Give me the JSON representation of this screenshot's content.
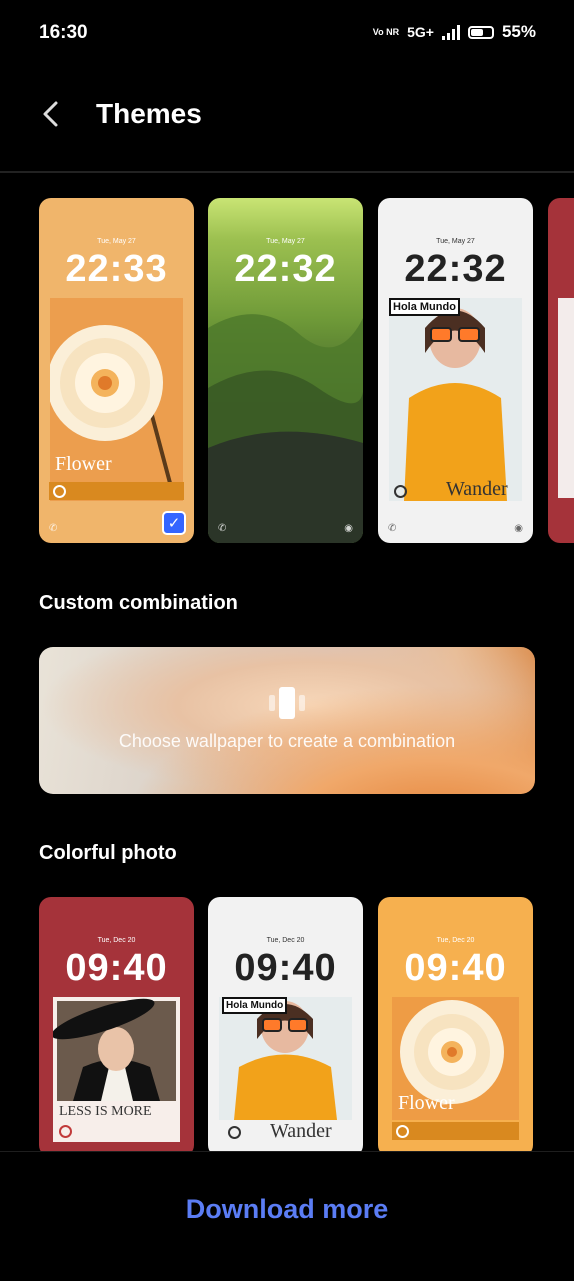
{
  "status": {
    "time": "16:30",
    "volte": "Vo NR",
    "network": "5G+",
    "battery": "55%",
    "battery_level": 0.55
  },
  "header": {
    "title": "Themes"
  },
  "themes": [
    {
      "date": "Tue, May 27",
      "clock": "22:33",
      "caption": "Flower",
      "selected": true
    },
    {
      "date": "Tue, May 27",
      "clock": "22:32"
    },
    {
      "date": "Tue, May 27",
      "clock": "22:32",
      "caption": "Wander",
      "sticker": "Hola Mundo"
    }
  ],
  "sections": {
    "custom": "Custom combination",
    "colorful": "Colorful photo"
  },
  "combo": {
    "text": "Choose wallpaper to create a combination"
  },
  "colorful": [
    {
      "date": "Tue, Dec 20",
      "clock": "09:40",
      "caption": "LESS IS MORE"
    },
    {
      "date": "Tue, Dec 20",
      "clock": "09:40",
      "caption": "Wander",
      "sticker": "Hola Mundo"
    },
    {
      "date": "Tue, Dec 20",
      "clock": "09:40",
      "caption": "Flower"
    }
  ],
  "footer": {
    "download": "Download more"
  },
  "colors": {
    "accent": "#5b7df5",
    "check": "#3465ff"
  }
}
